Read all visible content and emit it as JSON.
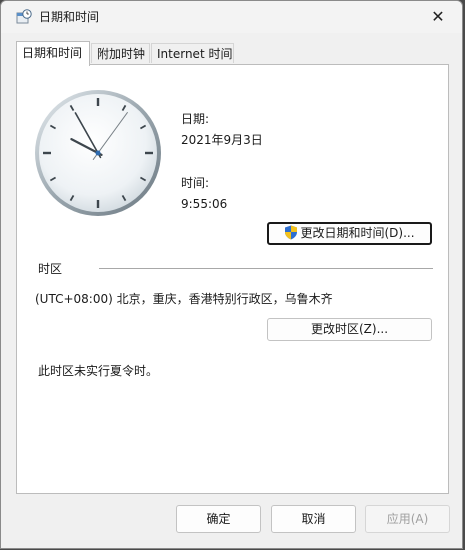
{
  "window": {
    "title": "日期和时间",
    "close_glyph": "✕"
  },
  "tabs": [
    {
      "label": "日期和时间",
      "active": true
    },
    {
      "label": "附加时钟",
      "active": false
    },
    {
      "label": "Internet 时间",
      "active": false
    }
  ],
  "date_time": {
    "date_label": "日期:",
    "date_value": "2021年9月3日",
    "time_label": "时间:",
    "time_value": "9:55:06",
    "change_button": "更改日期和时间(D)..."
  },
  "clock": {
    "hour": 9,
    "minute": 55,
    "second": 6
  },
  "timezone": {
    "section_label": "时区",
    "value": "(UTC+08:00) 北京，重庆，香港特别行政区，乌鲁木齐",
    "change_button": "更改时区(Z)...",
    "dst_note": "此时区未实行夏令时。"
  },
  "footer": {
    "ok": "确定",
    "cancel": "取消",
    "apply": "应用(A)"
  }
}
